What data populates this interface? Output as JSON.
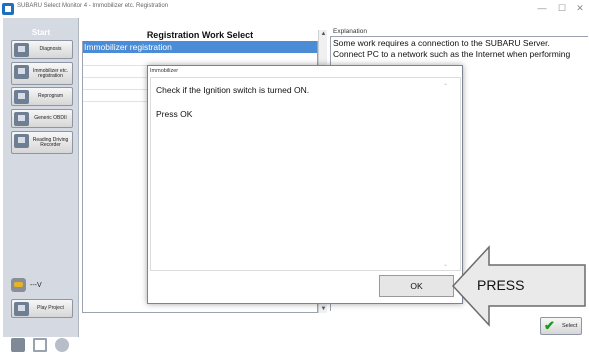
{
  "window": {
    "title": "SUBARU Select Monitor 4 - Immobilizer etc. Registration",
    "controls": [
      "—",
      "☐",
      "✕"
    ]
  },
  "sidebar": {
    "start_label": "Start",
    "items": [
      {
        "label": "Diagnosis",
        "icon": "diagnosis-icon"
      },
      {
        "label": "Immobilizer etc. registration",
        "icon": "immobilizer-icon"
      },
      {
        "label": "Reprogram",
        "icon": "reprogram-icon"
      },
      {
        "label": "Generic OBDII",
        "icon": "obd-icon"
      },
      {
        "label": "Reading Driving Recorder",
        "icon": "recorder-icon"
      },
      {
        "label": "Play Project",
        "icon": "play-project-icon"
      }
    ],
    "vehicle_value": "---V"
  },
  "main": {
    "header": "Registration Work Select",
    "selected_item": "Immobilizer registration"
  },
  "explanation": {
    "label": "Explanation",
    "line1": "Some work requires a connection to the SUBARU Server.",
    "line2": "Connect PC to a network such as the Internet when performing"
  },
  "dialog": {
    "title": "Immobilizer",
    "message1": "Check if the Ignition switch is turned ON.",
    "message2": "Press OK",
    "ok_label": "OK"
  },
  "callout": {
    "label": "PRESS"
  },
  "footer": {
    "select_label": "Select"
  },
  "colors": {
    "selection": "#4a8cd6",
    "sidebar_bg": "#d5dae2",
    "callout_fill": "#eaeaea"
  }
}
